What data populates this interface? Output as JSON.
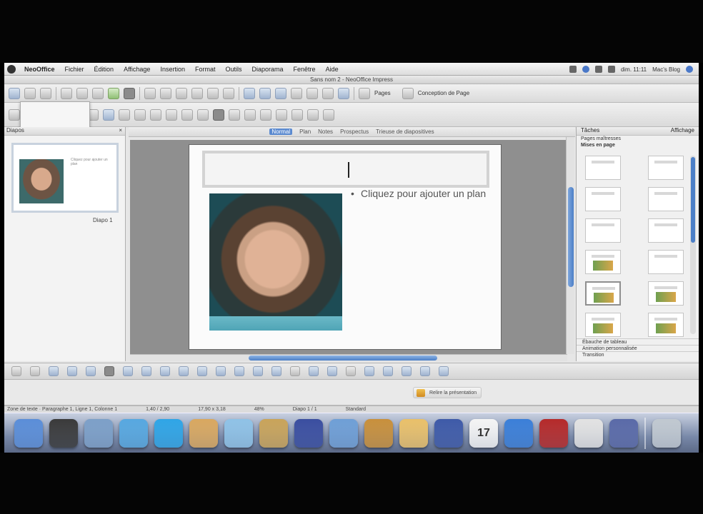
{
  "menubar": {
    "app_name": "NeoOffice",
    "items": [
      "Fichier",
      "Édition",
      "Affichage",
      "Insertion",
      "Format",
      "Outils",
      "Diaporama",
      "Fenêtre",
      "Aide"
    ],
    "clock": "dim. 11:11",
    "user": "Mac's Blog"
  },
  "window": {
    "title": "Sans nom 2 - NeoOffice Impress"
  },
  "toolbar": {
    "pages_label": "Pages",
    "layout_label": "Conception de Page"
  },
  "slides_pane": {
    "header": "Diapos",
    "thumb_label": "Diapo 1"
  },
  "view_tabs": [
    {
      "label": "Normal",
      "active": true
    },
    {
      "label": "Plan",
      "active": false
    },
    {
      "label": "Notes",
      "active": false
    },
    {
      "label": "Prospectus",
      "active": false
    },
    {
      "label": "Trieuse de diapositives",
      "active": false
    }
  ],
  "slide": {
    "content_placeholder": "Cliquez pour ajouter un plan"
  },
  "tasks_pane": {
    "header": "Tâches",
    "view_label": "Affichage",
    "sections": [
      "Pages maîtresses",
      "Mises en page"
    ],
    "collapsed_sections": [
      "Ébauche de tableau",
      "Animation personnalisée",
      "Transition"
    ]
  },
  "present_bar": {
    "label": "Relire la présentation"
  },
  "statusbar": {
    "left": "Zone de texte · Paragraphe 1, Ligne 1, Colonne 1",
    "position": "1,40 / 2,90",
    "size": "17,90 x 3,18",
    "zoom": "48%",
    "slide": "Diapo 1 / 1",
    "master": "Standard"
  },
  "dock": {
    "icons": [
      "finder-icon",
      "dvd-player-icon",
      "preview-icon",
      "safari-icon",
      "skype-icon",
      "notes-icon",
      "itunes-icon",
      "photo-icon",
      "imovie-icon",
      "iphoto-icon",
      "garageband-icon",
      "folder-icon",
      "idvd-icon",
      "ical-icon",
      "iweb-icon",
      "photo-booth-icon",
      "system-preferences-icon",
      "downloads-icon",
      "trash-icon"
    ],
    "ical_day": "17",
    "colors": [
      "#5b8ed8",
      "#3a3a3a",
      "#7da0c8",
      "#57a8e0",
      "#2fa5e6",
      "#d9a860",
      "#8fc2e6",
      "#c9a45a",
      "#3a4ea0",
      "#6f9fd6",
      "#c8903c",
      "#e9c06a",
      "#3e5aa8",
      "#f4f4f4",
      "#3b7fd8",
      "#b52a2a",
      "#e2e2e2",
      "#5a6aa8",
      "#c0c8d0"
    ]
  }
}
